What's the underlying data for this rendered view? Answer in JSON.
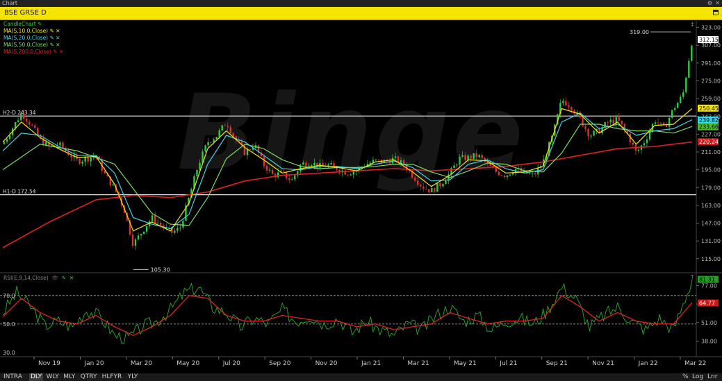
{
  "window": {
    "title": "Chart"
  },
  "header": {
    "symbol": "BSE GRSE D"
  },
  "legend": {
    "items": [
      {
        "label": "CandleChart",
        "color": "#2ecc40"
      },
      {
        "label": "MA(S,10.0,Close)",
        "color": "#f5e400"
      },
      {
        "label": "MA(S,20.0,Close)",
        "color": "#39d6e8"
      },
      {
        "label": "MA(S,50.0,Close)",
        "color": "#7ddc5a"
      },
      {
        "label": "MA(S,200.0,Close)",
        "color": "#e02020"
      }
    ]
  },
  "rsi_panel": {
    "label": "RSI(E,9,14,Close)"
  },
  "bottom_bar": {
    "periods": [
      "INTRA",
      "DLY",
      "WLY",
      "MLY",
      "QTRY",
      "HLFYR",
      "YLY"
    ],
    "selected": "DLY",
    "right": [
      "%",
      "Log",
      "Lnr"
    ]
  },
  "watermark": "Binge",
  "chart_data": [
    {
      "type": "line",
      "panel": "price",
      "x_ticks": [
        "Nov 19",
        "Jan 20",
        "Mar 20",
        "May 20",
        "Jul 20",
        "Sep 20",
        "Nov 20",
        "Jan 21",
        "Mar 21",
        "May 21",
        "Jul 21",
        "Sep 21",
        "Nov 21",
        "Jan 22",
        "Mar 22"
      ],
      "y_ticks": [
        323.0,
        307.0,
        291.0,
        275.0,
        259.0,
        243.0,
        227.0,
        211.0,
        195.0,
        179.0,
        163.0,
        147.0,
        131.0,
        115.0
      ],
      "ylim": [
        103,
        329
      ],
      "annotations": {
        "high": "319.00",
        "low": "105.30"
      },
      "hlines": [
        {
          "label": "H2-D 243.34",
          "value": 243.34
        },
        {
          "label": "H1-D 172.54",
          "value": 172.54
        }
      ],
      "last_values": {
        "close": "312.15",
        "ma10": "250.45",
        "ma20": "239.82",
        "ma50": "233.66",
        "ma200": "220.24"
      },
      "close_path": [
        [
          0,
          218
        ],
        [
          4,
          232
        ],
        [
          8,
          246
        ],
        [
          12,
          236
        ],
        [
          16,
          222
        ],
        [
          20,
          215
        ],
        [
          24,
          218
        ],
        [
          28,
          210
        ],
        [
          32,
          203
        ],
        [
          36,
          205
        ],
        [
          40,
          208
        ],
        [
          44,
          190
        ],
        [
          48,
          178
        ],
        [
          52,
          160
        ],
        [
          56,
          128
        ],
        [
          60,
          140
        ],
        [
          64,
          152
        ],
        [
          68,
          145
        ],
        [
          72,
          138
        ],
        [
          76,
          142
        ],
        [
          80,
          170
        ],
        [
          84,
          200
        ],
        [
          88,
          220
        ],
        [
          92,
          226
        ],
        [
          96,
          238
        ],
        [
          100,
          222
        ],
        [
          104,
          210
        ],
        [
          108,
          218
        ],
        [
          112,
          200
        ],
        [
          116,
          190
        ],
        [
          120,
          192
        ],
        [
          124,
          185
        ],
        [
          128,
          200
        ],
        [
          132,
          202
        ],
        [
          136,
          198
        ],
        [
          140,
          199
        ],
        [
          144,
          196
        ],
        [
          148,
          192
        ],
        [
          152,
          195
        ],
        [
          156,
          200
        ],
        [
          160,
          203
        ],
        [
          164,
          202
        ],
        [
          168,
          205
        ],
        [
          172,
          200
        ],
        [
          176,
          190
        ],
        [
          180,
          180
        ],
        [
          184,
          176
        ],
        [
          188,
          182
        ],
        [
          192,
          192
        ],
        [
          196,
          205
        ],
        [
          200,
          206
        ],
        [
          204,
          208
        ],
        [
          208,
          200
        ],
        [
          212,
          193
        ],
        [
          216,
          190
        ],
        [
          220,
          196
        ],
        [
          224,
          192
        ],
        [
          228,
          190
        ],
        [
          232,
          202
        ],
        [
          236,
          225
        ],
        [
          240,
          258
        ],
        [
          244,
          252
        ],
        [
          248,
          240
        ],
        [
          252,
          226
        ],
        [
          256,
          230
        ],
        [
          260,
          238
        ],
        [
          264,
          240
        ],
        [
          268,
          228
        ],
        [
          272,
          210
        ],
        [
          276,
          222
        ],
        [
          280,
          240
        ],
        [
          284,
          232
        ],
        [
          288,
          250
        ],
        [
          292,
          262
        ],
        [
          296,
          312
        ]
      ],
      "ma10": [
        [
          0,
          220
        ],
        [
          8,
          238
        ],
        [
          16,
          224
        ],
        [
          24,
          214
        ],
        [
          32,
          206
        ],
        [
          40,
          207
        ],
        [
          48,
          182
        ],
        [
          56,
          140
        ],
        [
          64,
          148
        ],
        [
          72,
          140
        ],
        [
          80,
          165
        ],
        [
          88,
          214
        ],
        [
          96,
          230
        ],
        [
          104,
          215
        ],
        [
          112,
          204
        ],
        [
          120,
          192
        ],
        [
          128,
          196
        ],
        [
          136,
          199
        ],
        [
          144,
          197
        ],
        [
          152,
          194
        ],
        [
          160,
          202
        ],
        [
          168,
          204
        ],
        [
          176,
          193
        ],
        [
          184,
          180
        ],
        [
          192,
          190
        ],
        [
          200,
          204
        ],
        [
          208,
          203
        ],
        [
          216,
          192
        ],
        [
          224,
          193
        ],
        [
          232,
          198
        ],
        [
          240,
          250
        ],
        [
          248,
          245
        ],
        [
          256,
          228
        ],
        [
          264,
          238
        ],
        [
          272,
          218
        ],
        [
          280,
          235
        ],
        [
          288,
          236
        ],
        [
          296,
          250
        ]
      ],
      "ma20": [
        [
          0,
          212
        ],
        [
          8,
          228
        ],
        [
          16,
          226
        ],
        [
          24,
          216
        ],
        [
          32,
          208
        ],
        [
          40,
          208
        ],
        [
          48,
          192
        ],
        [
          56,
          152
        ],
        [
          64,
          146
        ],
        [
          72,
          142
        ],
        [
          80,
          155
        ],
        [
          88,
          200
        ],
        [
          96,
          226
        ],
        [
          104,
          220
        ],
        [
          112,
          208
        ],
        [
          120,
          196
        ],
        [
          128,
          195
        ],
        [
          136,
          198
        ],
        [
          144,
          198
        ],
        [
          152,
          196
        ],
        [
          160,
          200
        ],
        [
          168,
          203
        ],
        [
          176,
          197
        ],
        [
          184,
          185
        ],
        [
          192,
          186
        ],
        [
          200,
          200
        ],
        [
          208,
          204
        ],
        [
          216,
          196
        ],
        [
          224,
          192
        ],
        [
          232,
          195
        ],
        [
          240,
          238
        ],
        [
          248,
          246
        ],
        [
          256,
          232
        ],
        [
          264,
          236
        ],
        [
          272,
          226
        ],
        [
          280,
          230
        ],
        [
          288,
          232
        ],
        [
          296,
          240
        ]
      ],
      "ma50": [
        [
          0,
          195
        ],
        [
          16,
          218
        ],
        [
          32,
          212
        ],
        [
          48,
          200
        ],
        [
          56,
          178
        ],
        [
          64,
          156
        ],
        [
          72,
          146
        ],
        [
          80,
          145
        ],
        [
          88,
          170
        ],
        [
          96,
          205
        ],
        [
          104,
          218
        ],
        [
          112,
          214
        ],
        [
          120,
          204
        ],
        [
          128,
          198
        ],
        [
          136,
          196
        ],
        [
          144,
          197
        ],
        [
          152,
          197
        ],
        [
          160,
          198
        ],
        [
          168,
          200
        ],
        [
          176,
          200
        ],
        [
          184,
          193
        ],
        [
          192,
          188
        ],
        [
          200,
          194
        ],
        [
          208,
          201
        ],
        [
          216,
          200
        ],
        [
          224,
          194
        ],
        [
          232,
          193
        ],
        [
          240,
          210
        ],
        [
          248,
          236
        ],
        [
          256,
          236
        ],
        [
          264,
          232
        ],
        [
          272,
          230
        ],
        [
          280,
          230
        ],
        [
          288,
          228
        ],
        [
          296,
          234
        ]
      ],
      "ma200": [
        [
          0,
          125
        ],
        [
          20,
          148
        ],
        [
          40,
          168
        ],
        [
          56,
          172
        ],
        [
          72,
          170
        ],
        [
          88,
          175
        ],
        [
          104,
          185
        ],
        [
          120,
          190
        ],
        [
          136,
          192
        ],
        [
          152,
          194
        ],
        [
          168,
          196
        ],
        [
          184,
          194
        ],
        [
          200,
          196
        ],
        [
          216,
          198
        ],
        [
          232,
          202
        ],
        [
          248,
          208
        ],
        [
          264,
          214
        ],
        [
          280,
          216
        ],
        [
          296,
          220
        ]
      ]
    },
    {
      "type": "line",
      "panel": "rsi",
      "y_ticks": [
        77.0,
        64.0,
        51.0,
        38.0
      ],
      "left_ticks": [
        "70.0",
        "50.0",
        "30.0"
      ],
      "ylim": [
        28,
        85
      ],
      "levels": [
        70,
        50
      ],
      "last_values": {
        "rsi": "81.31",
        "signal": "64.77"
      },
      "rsi": [
        [
          0,
          58
        ],
        [
          6,
          72
        ],
        [
          12,
          62
        ],
        [
          18,
          49
        ],
        [
          24,
          52
        ],
        [
          30,
          48
        ],
        [
          36,
          60
        ],
        [
          42,
          55
        ],
        [
          48,
          42
        ],
        [
          54,
          40
        ],
        [
          60,
          48
        ],
        [
          66,
          52
        ],
        [
          72,
          60
        ],
        [
          78,
          72
        ],
        [
          84,
          76
        ],
        [
          90,
          62
        ],
        [
          96,
          58
        ],
        [
          102,
          48
        ],
        [
          108,
          54
        ],
        [
          114,
          50
        ],
        [
          120,
          60
        ],
        [
          126,
          52
        ],
        [
          132,
          56
        ],
        [
          138,
          50
        ],
        [
          144,
          54
        ],
        [
          150,
          44
        ],
        [
          156,
          52
        ],
        [
          162,
          46
        ],
        [
          168,
          42
        ],
        [
          174,
          50
        ],
        [
          180,
          46
        ],
        [
          186,
          56
        ],
        [
          192,
          62
        ],
        [
          198,
          52
        ],
        [
          204,
          56
        ],
        [
          210,
          46
        ],
        [
          216,
          52
        ],
        [
          222,
          54
        ],
        [
          228,
          50
        ],
        [
          234,
          60
        ],
        [
          240,
          76
        ],
        [
          246,
          68
        ],
        [
          252,
          48
        ],
        [
          258,
          56
        ],
        [
          264,
          62
        ],
        [
          270,
          52
        ],
        [
          276,
          46
        ],
        [
          282,
          54
        ],
        [
          288,
          46
        ],
        [
          296,
          81
        ]
      ],
      "signal": [
        [
          0,
          55
        ],
        [
          8,
          68
        ],
        [
          16,
          58
        ],
        [
          24,
          52
        ],
        [
          32,
          50
        ],
        [
          40,
          56
        ],
        [
          48,
          48
        ],
        [
          56,
          42
        ],
        [
          64,
          48
        ],
        [
          72,
          56
        ],
        [
          80,
          70
        ],
        [
          88,
          68
        ],
        [
          96,
          56
        ],
        [
          104,
          52
        ],
        [
          112,
          52
        ],
        [
          120,
          56
        ],
        [
          128,
          54
        ],
        [
          136,
          52
        ],
        [
          144,
          52
        ],
        [
          152,
          48
        ],
        [
          160,
          50
        ],
        [
          168,
          46
        ],
        [
          176,
          48
        ],
        [
          184,
          50
        ],
        [
          192,
          58
        ],
        [
          200,
          54
        ],
        [
          208,
          50
        ],
        [
          216,
          52
        ],
        [
          224,
          52
        ],
        [
          232,
          54
        ],
        [
          240,
          70
        ],
        [
          248,
          62
        ],
        [
          256,
          52
        ],
        [
          264,
          58
        ],
        [
          272,
          52
        ],
        [
          280,
          50
        ],
        [
          288,
          50
        ],
        [
          296,
          65
        ]
      ]
    }
  ]
}
